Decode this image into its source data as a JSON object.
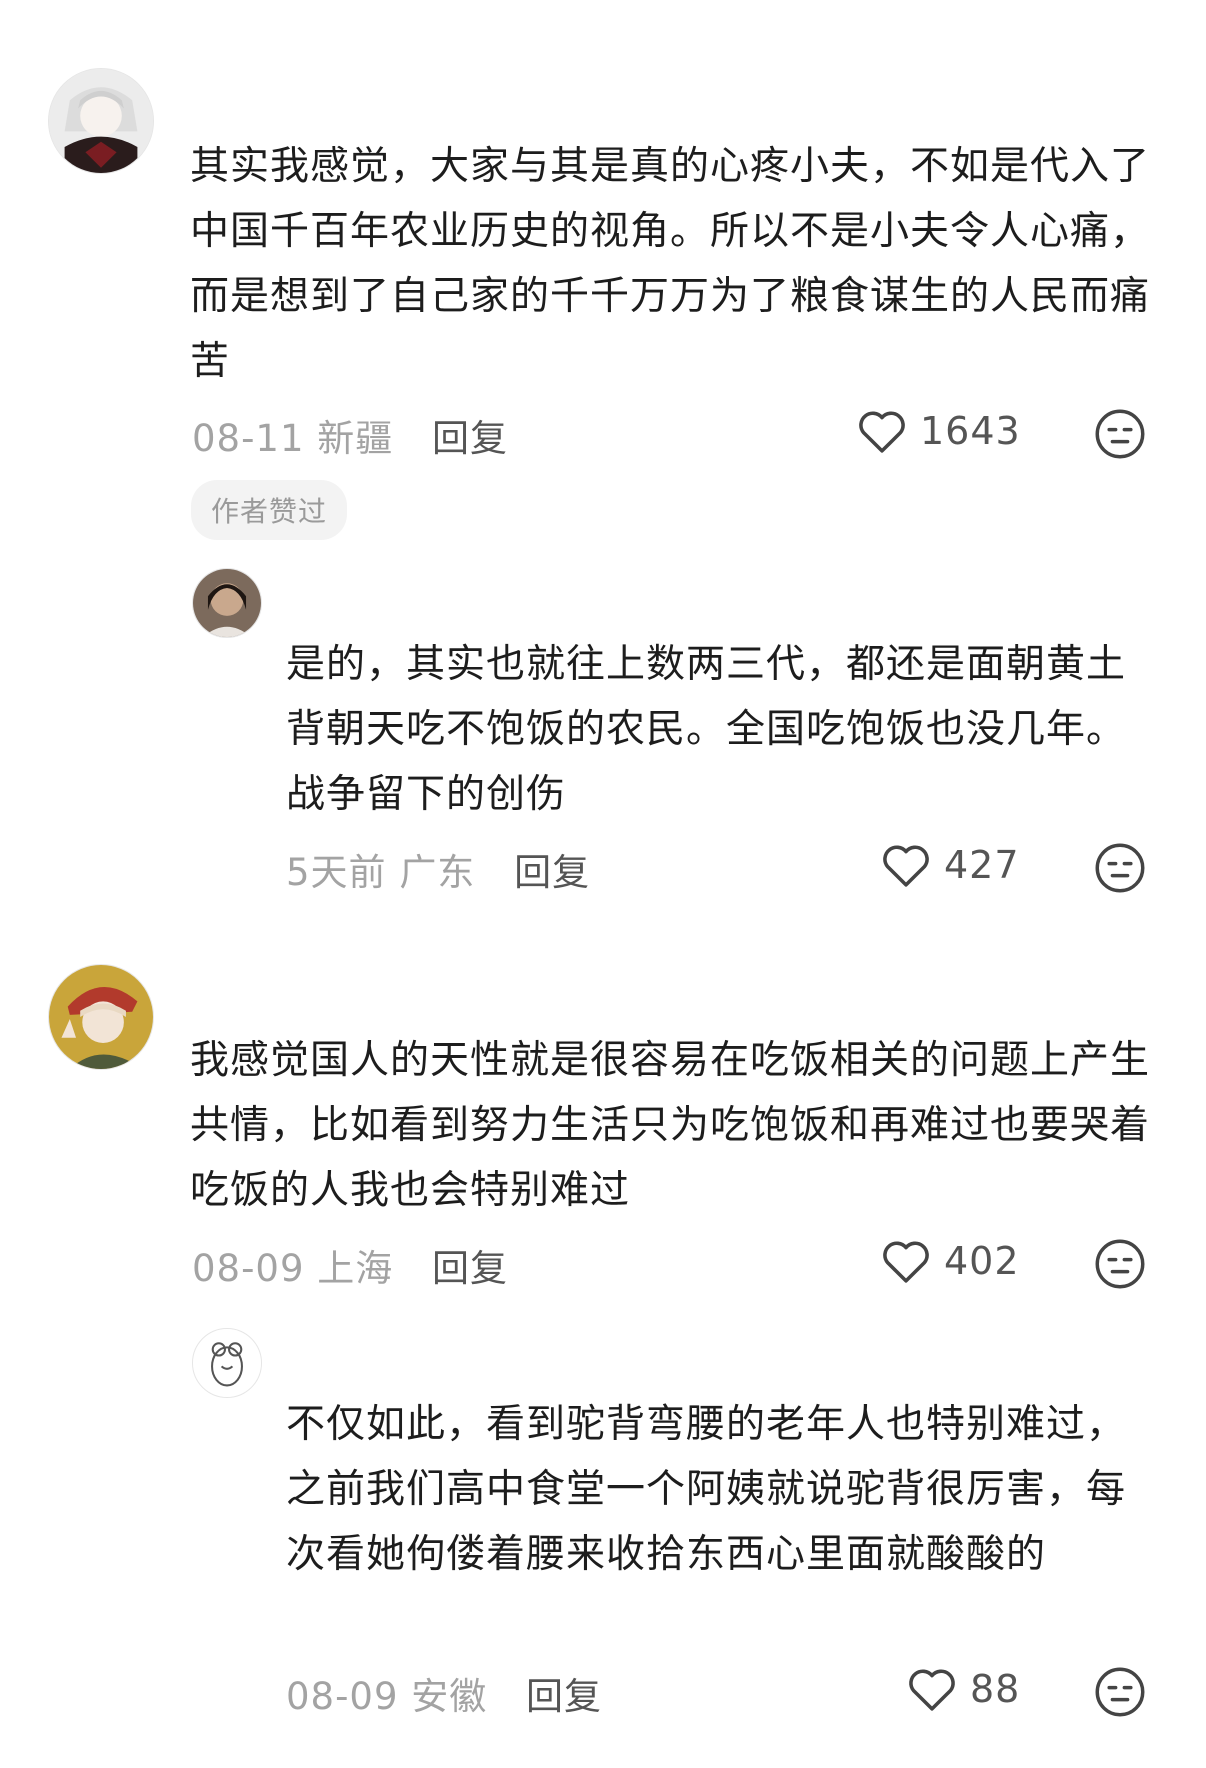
{
  "comments": [
    {
      "text": "其实我感觉，大家与其是真的心疼小夫，不如是代入了中国千百年农业历史的视角。所以不是小夫令人心痛，而是想到了自己家的千千万万为了粮食谋生的人民而痛苦",
      "date": "08-11",
      "location": "新疆",
      "reply_label": "回复",
      "likes": "1643",
      "badge": "作者赞过"
    },
    {
      "text": "是的，其实也就往上数两三代，都还是面朝黄土背朝天吃不饱饭的农民。全国吃饱饭也没几年。战争留下的创伤",
      "date": "5天前",
      "location": "广东",
      "reply_label": "回复",
      "likes": "427"
    },
    {
      "text": "我感觉国人的天性就是很容易在吃饭相关的问题上产生共情，比如看到努力生活只为吃饱饭和再难过也要哭着吃饭的人我也会特别难过",
      "date": "08-09",
      "location": "上海",
      "reply_label": "回复",
      "likes": "402"
    },
    {
      "text": "不仅如此，看到驼背弯腰的老年人也特别难过，之前我们高中食堂一个阿姨就说驼背很厉害，每次看她佝偻着腰来收拾东西心里面就酸酸的",
      "date": "08-09",
      "location": "安徽",
      "reply_label": "回复",
      "likes": "88"
    }
  ],
  "icons": {
    "like": "heart-outline-icon",
    "dislike": "meh-face-icon"
  }
}
